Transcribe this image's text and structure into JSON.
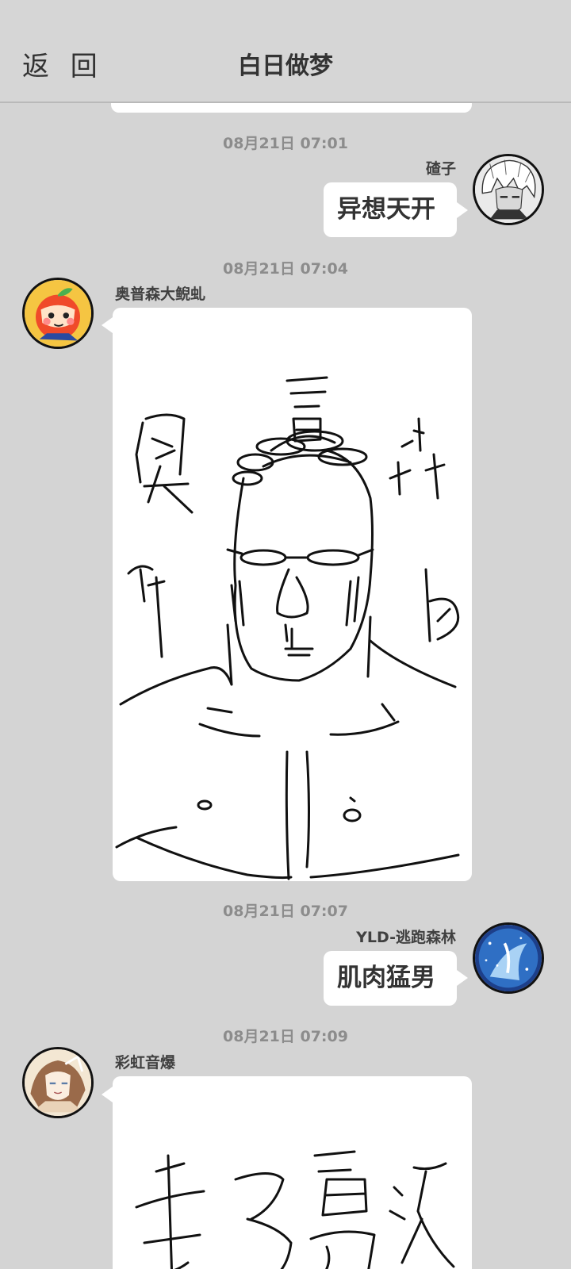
{
  "header": {
    "back_label": "返 回",
    "title": "白日做梦"
  },
  "messages": [
    {
      "timestamp": "08月21日  07:01",
      "sender": "碴子",
      "side": "right",
      "type": "text",
      "text": "异想天开",
      "avatar_icon": "anime-boy-avatar"
    },
    {
      "timestamp": "08月21日  07:04",
      "sender": "奥普森大鲵虬",
      "side": "left",
      "type": "image",
      "image_description": "hand-drawn doodle",
      "avatar_icon": "apple-character-avatar"
    },
    {
      "timestamp": "08月21日  07:07",
      "sender": "YLD-逃跑森林",
      "side": "right",
      "type": "text",
      "text": "肌肉猛男",
      "avatar_icon": "starry-night-avatar"
    },
    {
      "timestamp": "08月21日  07:09",
      "sender": "彩虹音爆",
      "side": "left",
      "type": "image",
      "image_description": "hand-drawn doodle",
      "avatar_icon": "anime-girl-avatar"
    }
  ],
  "colors": {
    "background": "#d4d4d4",
    "bubble": "#ffffff",
    "timestamp": "#8c8c8c",
    "text": "#333333"
  }
}
